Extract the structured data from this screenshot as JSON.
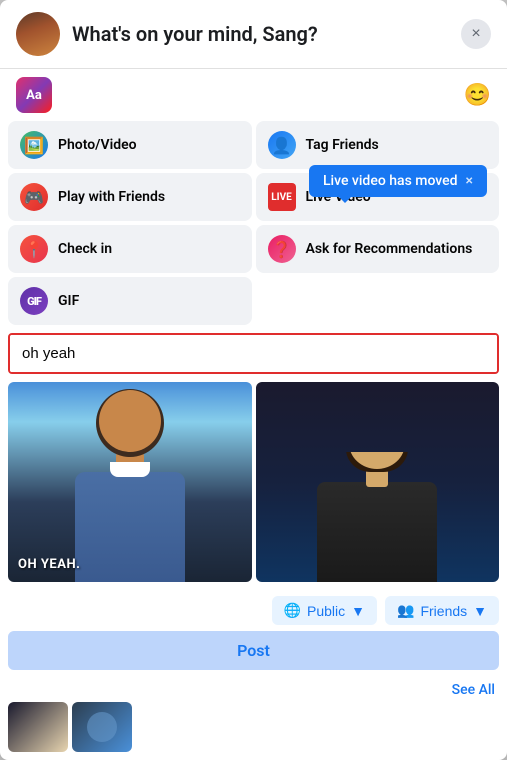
{
  "modal": {
    "header": {
      "title": "What's on your mind, Sang?",
      "close_label": "×"
    },
    "toolbar": {
      "ab_label": "Aa",
      "emoji_icon": "😊"
    },
    "options": [
      {
        "id": "photo-video",
        "label": "Photo/Video",
        "icon_type": "photo"
      },
      {
        "id": "tag-friends",
        "label": "Tag Friends",
        "icon_type": "tag"
      },
      {
        "id": "play-friends",
        "label": "Play with Friends",
        "icon_type": "play"
      },
      {
        "id": "live-video",
        "label": "Live Video",
        "icon_type": "live"
      },
      {
        "id": "check-in",
        "label": "Check in",
        "icon_type": "checkin"
      },
      {
        "id": "ask-recommendations",
        "label": "Ask for Recommendations",
        "icon_type": "ask"
      },
      {
        "id": "gif",
        "label": "GIF",
        "icon_type": "gif"
      }
    ],
    "tooltip": {
      "text": "Live video has moved",
      "close": "×"
    },
    "search": {
      "placeholder": "oh yeah",
      "value": "oh yeah"
    },
    "gif_results": {
      "oh_yeah_caption": "OH YEAH.",
      "see_all_label": "See All"
    },
    "footer": {
      "public_label": "Public",
      "friends_label": "Friends",
      "post_label": "Post"
    }
  }
}
